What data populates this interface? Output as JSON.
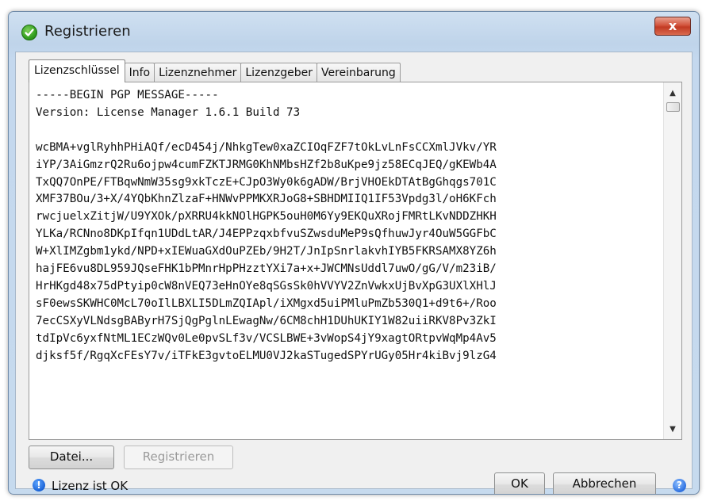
{
  "window": {
    "title": "Registrieren",
    "close_label": "x"
  },
  "tabs": [
    {
      "label": "Lizenzschlüssel"
    },
    {
      "label": "Info"
    },
    {
      "label": "Lizenznehmer"
    },
    {
      "label": "Lizenzgeber"
    },
    {
      "label": "Vereinbarung"
    }
  ],
  "license_text": "-----BEGIN PGP MESSAGE-----\nVersion: License Manager 1.6.1 Build 73\n\nwcBMA+vglRyhhPHiAQf/ecD454j/NhkgTew0xaZCIOqFZF7tOkLvLnFsCCXmlJVkv/YR\niYP/3AiGmzrQ2Ru6ojpw4cumFZKTJRMG0KhNMbsHZf2b8uKpe9jz58ECqJEQ/gKEWb4A\nTxQQ7OnPE/FTBqwNmW35sg9xkTczE+CJpO3Wy0k6gADW/BrjVHOEkDTAtBgGhqgs701C\nXMF37BOu/3+X/4YQbKhnZlzaF+HNWvPPMKXRJoG8+SBHDMIIQ1IF53Vpdg3l/oH6KFch\nrwcjuelxZitjW/U9YXOk/pXRRU4kkNOlHGPK5ouH0M6Yy9EKQuXRojFMRtLKvNDDZHKH\nYLKa/RCNno8DKpIfqn1UDdLtAR/J4EPPzqxbfvuSZwsduMeP9sQfhuwJyr4OuW5GGFbC\nW+XlIMZgbm1ykd/NPD+xIEWuaGXdOuPZEb/9H2T/JnIpSnrlakvhIYB5FKRSAMX8YZ6h\nhajFE6vu8DL959JQseFHK1bPMnrHpPHzztYXi7a+x+JWCMNsUddl7uwO/gG/V/m23iB/\nHrHKgd48x75dPtyip0cW8nVEQ73eHnOYe8qSGsSk0hVVYV2ZnVwkxUjBvXpG3UXlXHlJ\nsF0ewsSKWHC0McL70oIlLBXLI5DLmZQIApl/iXMgxd5uiPMluPmZb530Q1+d9t6+/Roo\n7ecCSXyVLNdsgBAByrH7SjQgPglnLEwagNw/6CM8chH1DUhUKIY1W82uiiRKV8Pv3ZkI\ntdIpVc6yxfNtML1ECzWQv0Le0pvSLf3v/VCSLBWE+3vWopS4jY9xagtORtpvWqMp4Av5\ndjksf5f/RgqXcFEsY7v/iTFkE3gvtoELMU0VJ2kaSTugedSPYrUGy05Hr4kiBvj9lzG4",
  "buttons": {
    "file": "Datei...",
    "register": "Registrieren",
    "ok": "OK",
    "cancel": "Abbrechen"
  },
  "status": {
    "text": "Lizenz ist OK"
  }
}
